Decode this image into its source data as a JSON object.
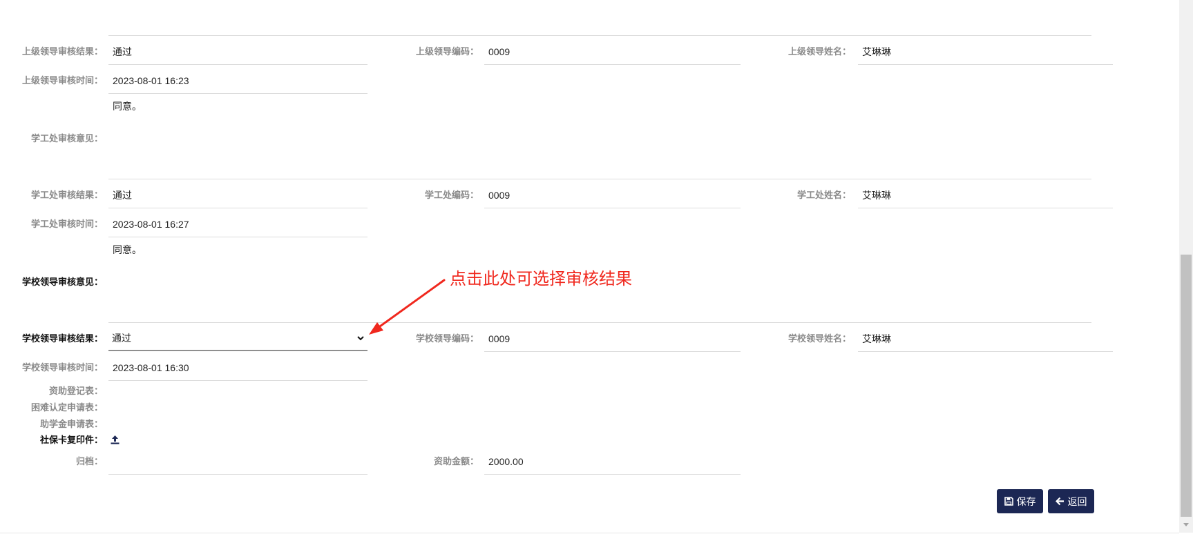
{
  "annotation": {
    "text": "点击此处可选择审核结果",
    "color": "#f0281e"
  },
  "superior": {
    "result": {
      "label": "上级领导审核结果：",
      "value": "通过"
    },
    "code": {
      "label": "上级领导编码：",
      "value": "0009"
    },
    "name": {
      "label": "上级领导姓名：",
      "value": "艾琳琳"
    },
    "time": {
      "label": "上级领导审核时间：",
      "value": "2023-08-01 16:23"
    }
  },
  "student_affairs": {
    "opinion": {
      "label": "学工处审核意见：",
      "value": "同意。"
    },
    "result": {
      "label": "学工处审核结果：",
      "value": "通过"
    },
    "code": {
      "label": "学工处编码：",
      "value": "0009"
    },
    "name": {
      "label": "学工处姓名：",
      "value": "艾琳琳"
    },
    "time": {
      "label": "学工处审核时间：",
      "value": "2023-08-01 16:27"
    }
  },
  "school_leader": {
    "opinion": {
      "label": "学校领导审核意见：",
      "value": "同意。"
    },
    "result": {
      "label": "学校领导审核结果：",
      "value": "通过"
    },
    "code": {
      "label": "学校领导编码：",
      "value": "0009"
    },
    "name": {
      "label": "学校领导姓名：",
      "value": "艾琳琳"
    },
    "time": {
      "label": "学校领导审核时间：",
      "value": "2023-08-01 16:30"
    }
  },
  "attachments": {
    "aid_registration": "资助登记表：",
    "hardship_application": "困难认定申请表：",
    "grant_application": "助学金申请表：",
    "social_security_card": "社保卡复印件：",
    "upload_icon": "upload-icon"
  },
  "archive": {
    "label": "归档："
  },
  "aid_amount": {
    "label": "资助金额：",
    "value": "2000.00"
  },
  "buttons": {
    "save": {
      "label": "保存",
      "icon": "save-icon"
    },
    "back": {
      "label": "返回",
      "icon": "arrow-left-icon"
    }
  },
  "colors": {
    "button": "#1c2754",
    "label": "#8a8a8a",
    "required_label": "#111111",
    "annotation": "#f0281e"
  }
}
